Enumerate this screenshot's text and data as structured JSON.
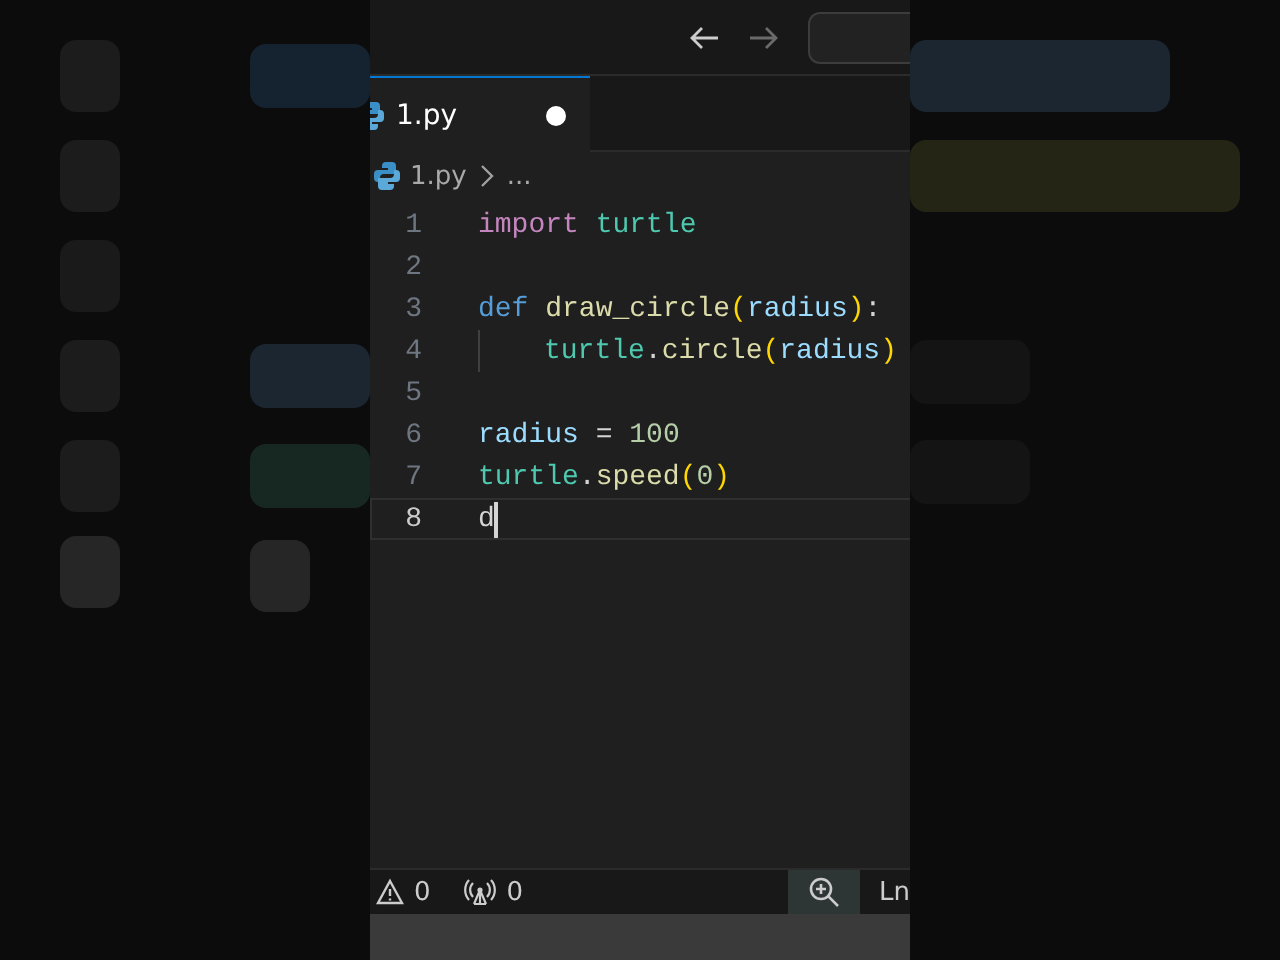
{
  "title_bar": {
    "nav": [
      {
        "kind": "back",
        "disabled": false
      },
      {
        "kind": "forward",
        "disabled": true
      }
    ]
  },
  "tabs": [
    {
      "label": "1.py",
      "selected": true,
      "modified": true
    }
  ],
  "breadcrumb": {
    "file": "1.py",
    "rest": "..."
  },
  "editor": {
    "lines": [
      {
        "number": "1",
        "indent": false,
        "active": false,
        "tokens": [
          {
            "kind": "keyword",
            "text": "import "
          },
          {
            "kind": "module",
            "text": "turtle"
          }
        ]
      },
      {
        "number": "2",
        "indent": false,
        "active": false
      },
      {
        "number": "3",
        "indent": false,
        "active": false,
        "tokens": [
          {
            "kind": "storage",
            "text": "def "
          },
          {
            "kind": "function",
            "text": "draw_circle"
          },
          {
            "kind": "paren",
            "text": "("
          },
          {
            "kind": "param",
            "text": "radius"
          },
          {
            "kind": "paren",
            "text": ")"
          },
          {
            "kind": "plain",
            "text": ":"
          }
        ]
      },
      {
        "number": "4",
        "indent": true,
        "active": false,
        "tokens": [
          {
            "kind": "module",
            "text": "turtle"
          },
          {
            "kind": "plain",
            "text": "."
          },
          {
            "kind": "function",
            "text": "circle"
          },
          {
            "kind": "paren",
            "text": "("
          },
          {
            "kind": "param",
            "text": "radius"
          },
          {
            "kind": "paren",
            "text": ")"
          }
        ]
      },
      {
        "number": "5",
        "indent": false,
        "active": false
      },
      {
        "number": "6",
        "indent": false,
        "active": false,
        "tokens": [
          {
            "kind": "param",
            "text": "radius"
          },
          {
            "kind": "plain",
            "text": " = "
          },
          {
            "kind": "number",
            "text": "100"
          }
        ]
      },
      {
        "number": "7",
        "indent": false,
        "active": false,
        "tokens": [
          {
            "kind": "module",
            "text": "turtle"
          },
          {
            "kind": "plain",
            "text": "."
          },
          {
            "kind": "function",
            "text": "speed"
          },
          {
            "kind": "paren",
            "text": "("
          },
          {
            "kind": "number",
            "text": "0"
          },
          {
            "kind": "paren",
            "text": ")"
          }
        ]
      },
      {
        "number": "8",
        "indent": false,
        "active": true,
        "tokens": [
          {
            "kind": "plain",
            "text": "d"
          }
        ]
      }
    ]
  },
  "status_bar": {
    "warnings": "0",
    "ports": "0",
    "position": "Ln"
  }
}
